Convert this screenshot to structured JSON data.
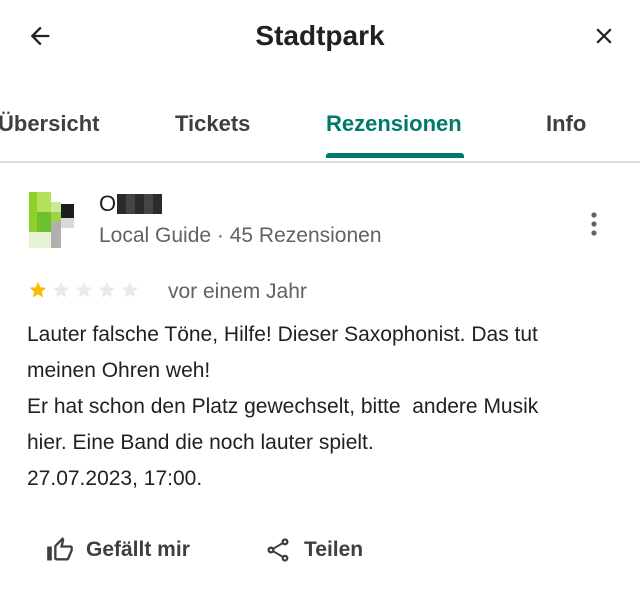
{
  "header": {
    "title": "Stadtpark",
    "back_icon": "arrow-back-icon",
    "close_icon": "close-icon"
  },
  "tabs": [
    {
      "label": "Übersicht",
      "active": false
    },
    {
      "label": "Tickets",
      "active": false
    },
    {
      "label": "Rezensionen",
      "active": true
    },
    {
      "label": "Info",
      "active": false
    }
  ],
  "colors": {
    "accent": "#00796b",
    "star_filled": "#fbbc04",
    "star_empty": "#e8eaed"
  },
  "review": {
    "author_initial": "O",
    "author_meta": "Local Guide · 45 Rezensionen",
    "rating": 1,
    "rating_max": 5,
    "date": "vor einem Jahr",
    "text_lines": [
      "Lauter falsche Töne, Hilfe! Dieser Saxophonist. Das tut",
      "meinen Ohren weh!",
      "Er hat schon den Platz gewechselt, bitte  andere Musik",
      "hier. Eine Band die noch lauter spielt.",
      "27.07.2023, 17:00."
    ]
  },
  "actions": {
    "like_label": "Gefällt mir",
    "share_label": "Teilen"
  }
}
